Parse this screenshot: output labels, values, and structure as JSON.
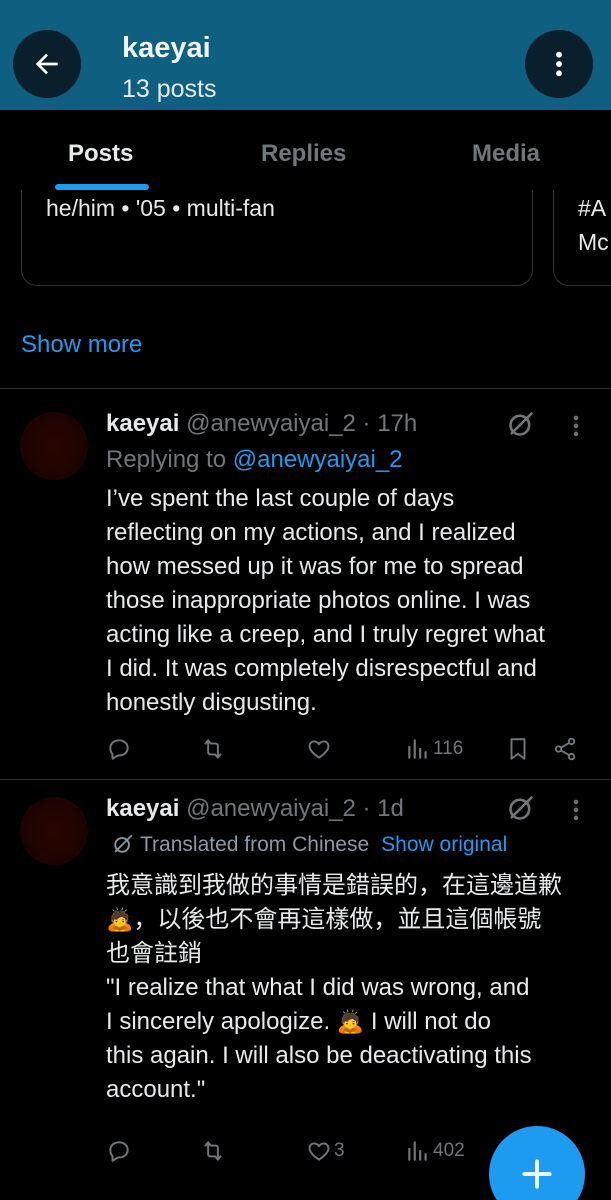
{
  "header": {
    "name": "kaeyai",
    "posts_count": "13 posts",
    "back_icon": "arrow-left-icon",
    "more_icon": "vertical-dots-icon"
  },
  "tabs": [
    {
      "label": "Posts",
      "active": true
    },
    {
      "label": "Replies",
      "active": false
    },
    {
      "label": "Media",
      "active": false
    }
  ],
  "bio_cards": [
    {
      "text": "he/him • '05 • multi-fan"
    },
    {
      "line1": "#A",
      "line2": "Mc"
    }
  ],
  "show_more": "Show more",
  "tweets": [
    {
      "name": "kaeyai",
      "handle_time": "@anewyaiyai_2 · 17h",
      "replying_prefix": "Replying to ",
      "replying_to": "@anewyaiyai_2",
      "lines": [
        "I’ve spent the last couple of days",
        "reflecting on my actions, and I realized",
        "how messed up it was for me to spread",
        "those inappropriate photos online. I was",
        "acting like a creep, and I truly regret what",
        "I did. It was completely disrespectful and",
        "honestly disgusting."
      ],
      "views": "116",
      "likes": ""
    },
    {
      "name": "kaeyai",
      "handle_time": "@anewyaiyai_2 · 1d",
      "translated_label": "Translated from Chinese",
      "show_original": "Show original",
      "zh_line1": "我意識到我做的事情是錯誤的，在這邊道歉",
      "zh_line2_emoji": "🙇",
      "zh_line2": "，以後也不會再這樣做，並且這個帳號",
      "zh_line3": "也會註銷",
      "en_line1": "\"I realize that what I did was wrong, and",
      "en_line2a": "I sincerely apologize. ",
      "en_line2_emoji": "🙇",
      "en_line2b": " I will not do",
      "en_line3": "this again. I will also be deactivating this",
      "en_line4": "account.\"",
      "likes": "3",
      "views": "402"
    }
  ],
  "colors": {
    "header_bg": "#0f5f80",
    "accent": "#1d9bf0",
    "muted": "#71767b",
    "text": "#e7e9ea"
  },
  "fab_icon": "plus-icon"
}
